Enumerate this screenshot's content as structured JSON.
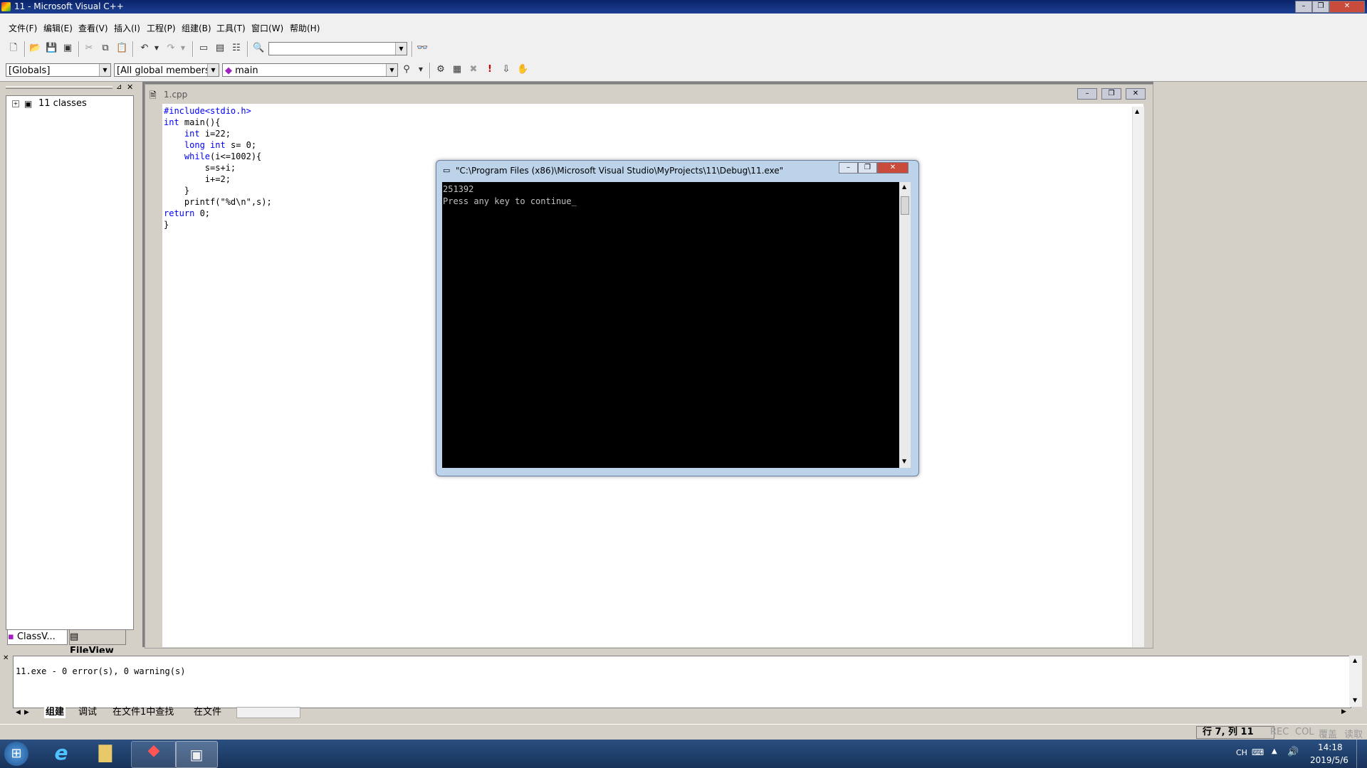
{
  "window": {
    "title": "11 - Microsoft Visual C++"
  },
  "menu": [
    "文件(F)",
    "编辑(E)",
    "查看(V)",
    "插入(I)",
    "工程(P)",
    "组建(B)",
    "工具(T)",
    "窗口(W)",
    "帮助(H)"
  ],
  "wizard_bar": {
    "scope": "[Globals]",
    "members": "[All global members",
    "function": "main"
  },
  "workspace": {
    "tree_root": "11 classes",
    "tabs": [
      "ClassV...",
      "FileView"
    ]
  },
  "editor": {
    "file_name": "1.cpp",
    "code": [
      "#include<stdio.h>",
      "int main(){",
      "    int i=22;",
      "    long int s= 0;",
      "    while(i<=1002){",
      "        s=s+i;",
      "        i+=2;",
      "    }",
      "    printf(\"%d\\n\",s);",
      "return 0;",
      "}"
    ]
  },
  "console": {
    "title": "\"C:\\Program Files (x86)\\Microsoft Visual Studio\\MyProjects\\11\\Debug\\11.exe\"",
    "output": "251392\nPress any key to continue_"
  },
  "output_pane": {
    "text": "11.exe - 0 error(s), 0 warning(s)",
    "tabs": [
      "组建",
      "调试",
      "在文件1中查找",
      "在文件"
    ]
  },
  "status": {
    "position": "行 7, 列 11",
    "indicators": [
      "REC",
      "COL",
      "覆盖",
      "读取"
    ]
  },
  "taskbar": {
    "lang": "CH",
    "time": "14:18",
    "date": "2019/5/6"
  },
  "colors": {
    "title_bar": "#0a246a",
    "keyword": "#0000ff",
    "console_bg": "#000000",
    "taskbar": "#1f3d6a"
  }
}
